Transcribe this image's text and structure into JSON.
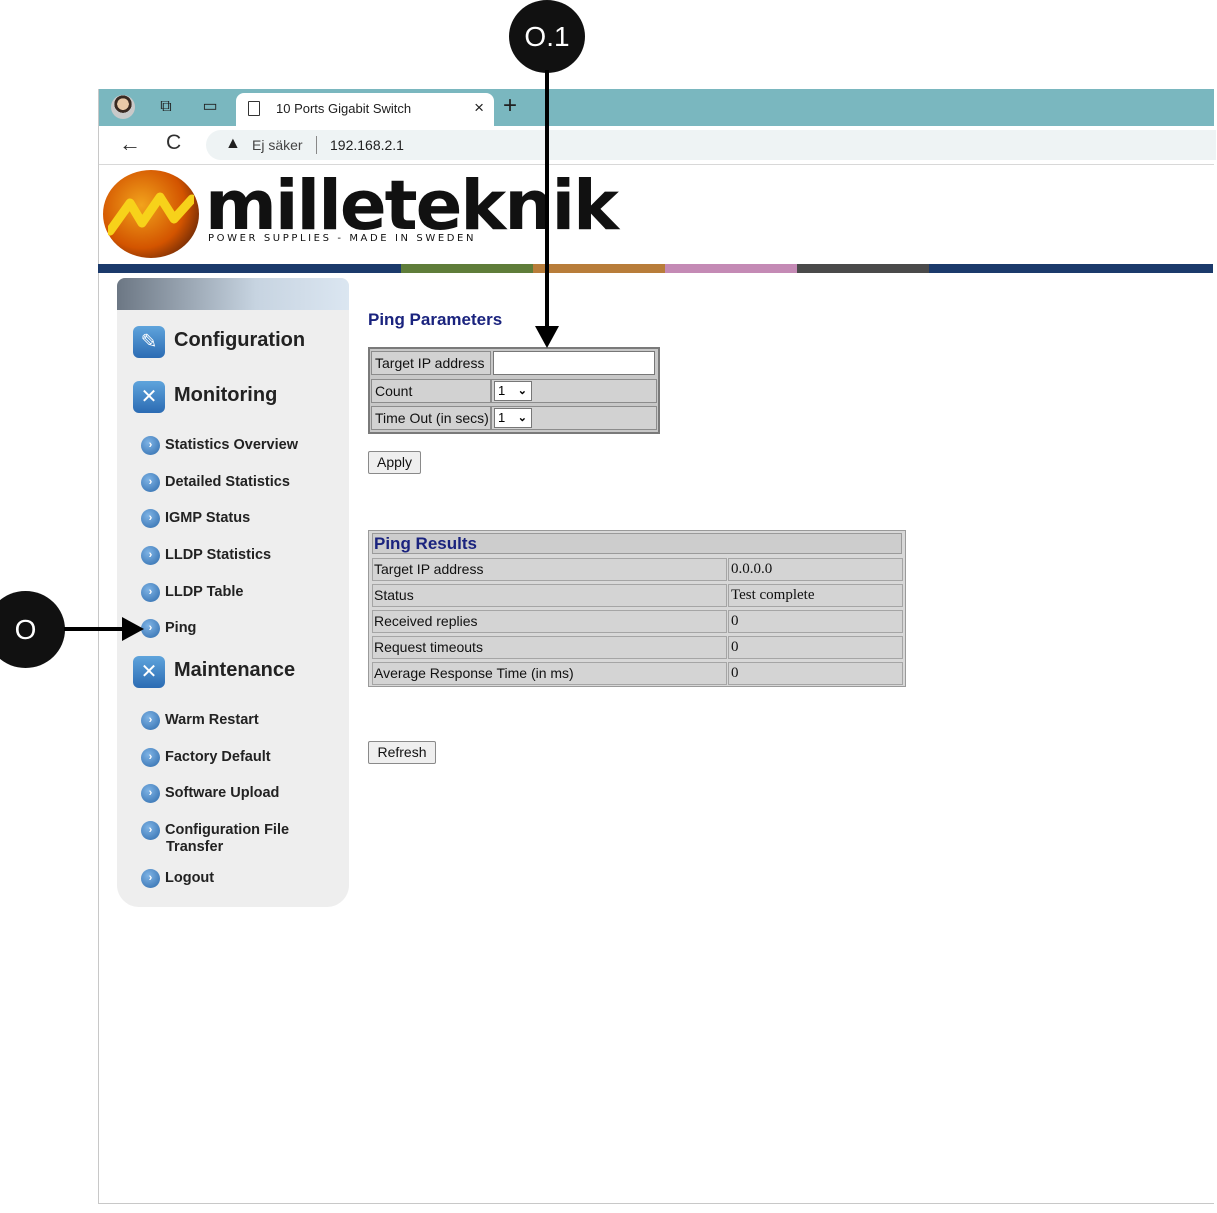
{
  "browser": {
    "tab_title": "10 Ports Gigabit Switch",
    "tab_close": "×",
    "new_tab": "+",
    "back": "←",
    "reload": "C",
    "security_warning_icon": "▲",
    "security_label": "Ej säker",
    "url": "192.168.2.1"
  },
  "brand": {
    "name": "milleteknik",
    "tagline": "POWER SUPPLIES - MADE IN SWEDEN",
    "stripe_colors": [
      "#1b3a6b",
      "#5f7d3a",
      "#b87d3a",
      "#c48ab5",
      "#4a4a4a",
      "#1b3a6b"
    ]
  },
  "sidebar": {
    "sections": [
      {
        "label": "Configuration",
        "icon": "configuration-icon"
      },
      {
        "label": "Monitoring",
        "icon": "tools-icon"
      },
      {
        "label": "Maintenance",
        "icon": "tools-icon"
      }
    ],
    "monitoring_items": [
      {
        "label": "Statistics Overview"
      },
      {
        "label": "Detailed Statistics"
      },
      {
        "label": "IGMP Status"
      },
      {
        "label": "LLDP Statistics"
      },
      {
        "label": "LLDP Table"
      },
      {
        "label": "Ping"
      }
    ],
    "maintenance_items": [
      {
        "label": "Warm Restart"
      },
      {
        "label": "Factory Default"
      },
      {
        "label": "Software Upload"
      },
      {
        "label": "Configuration File",
        "label2": "Transfer"
      },
      {
        "label": "Logout"
      }
    ]
  },
  "ping_params": {
    "heading": "Ping Parameters",
    "target_label": "Target IP address",
    "target_value": "",
    "count_label": "Count",
    "count_value": "1",
    "timeout_label": "Time Out (in secs)",
    "timeout_value": "1",
    "apply_label": "Apply"
  },
  "ping_results": {
    "heading": "Ping Results",
    "rows": [
      {
        "label": "Target IP address",
        "value": "0.0.0.0"
      },
      {
        "label": "Status",
        "value": "Test complete"
      },
      {
        "label": "Received replies",
        "value": "0"
      },
      {
        "label": "Request timeouts",
        "value": "0"
      },
      {
        "label": "Average Response Time (in ms)",
        "value": "0"
      }
    ],
    "refresh_label": "Refresh"
  },
  "callouts": {
    "top": "O.1",
    "left": "O"
  }
}
